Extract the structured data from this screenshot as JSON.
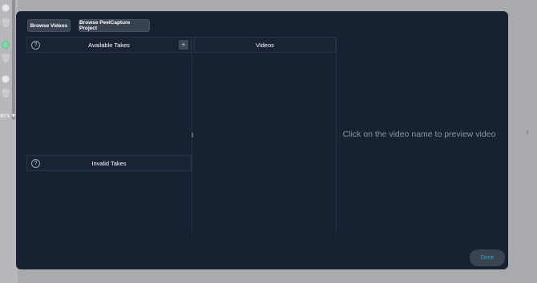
{
  "background": {
    "more_label": "ers ▾"
  },
  "toolbar": {
    "browse_videos_label": "Browse Videos",
    "browse_project_label": "Browse PeelCapture Project"
  },
  "available_takes": {
    "title": "Available Takes",
    "help_glyph": "?",
    "add_glyph": "+"
  },
  "invalid_takes": {
    "title": "Invalid Takes",
    "help_glyph": "?"
  },
  "videos": {
    "title": "Videos"
  },
  "preview": {
    "message": "Click on the video name to preview video"
  },
  "footer": {
    "done_label": "Done"
  },
  "colors": {
    "modal_bg": "#182131",
    "accent": "#2fa3c8",
    "status_green": "#7fd6a1"
  }
}
